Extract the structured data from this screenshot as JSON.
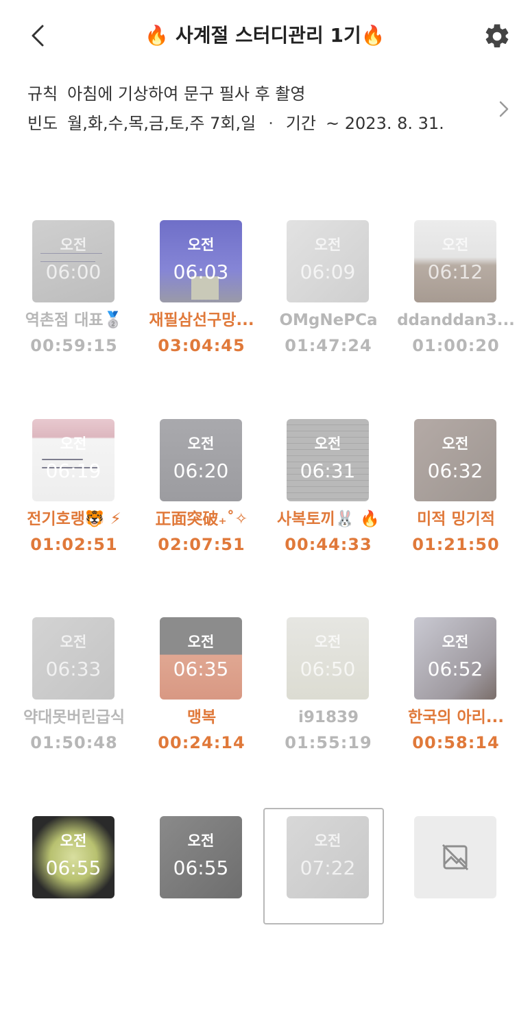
{
  "header": {
    "title": "🔥 사계절 스터디관리 1기🔥"
  },
  "info": {
    "rule_label": "규칙",
    "rule_value": "아침에 기상하여 문구 필사 후 촬영",
    "freq_label": "빈도",
    "freq_value": "월,화,수,목,금,토,주 7회,일",
    "separator": "·",
    "period_label": "기간",
    "period_value": "~ 2023. 8. 31."
  },
  "members": [
    {
      "ampm": "오전",
      "time": "06:00",
      "name": "역촌점 대표🥈",
      "duration": "00:59:15",
      "status": "gray"
    },
    {
      "ampm": "오전",
      "time": "06:03",
      "name": "재필삼선구망...",
      "duration": "03:04:45",
      "status": "orange"
    },
    {
      "ampm": "오전",
      "time": "06:09",
      "name": "OMgNePCa",
      "duration": "01:47:24",
      "status": "gray"
    },
    {
      "ampm": "오전",
      "time": "06:12",
      "name": "ddanddan3...",
      "duration": "01:00:20",
      "status": "gray"
    },
    {
      "ampm": "오전",
      "time": "06:19",
      "name": "전기호랭🐯 ⚡",
      "duration": "01:02:51",
      "status": "orange"
    },
    {
      "ampm": "오전",
      "time": "06:20",
      "name": "正面突破₊˚✧",
      "duration": "02:07:51",
      "status": "orange"
    },
    {
      "ampm": "오전",
      "time": "06:31",
      "name": "사복토끼🐰 🔥",
      "duration": "00:44:33",
      "status": "orange"
    },
    {
      "ampm": "오전",
      "time": "06:32",
      "name": "미적 밍기적",
      "duration": "01:21:50",
      "status": "orange"
    },
    {
      "ampm": "오전",
      "time": "06:33",
      "name": "약대못버린급식",
      "duration": "01:50:48",
      "status": "gray"
    },
    {
      "ampm": "오전",
      "time": "06:35",
      "name": "맹복",
      "duration": "00:24:14",
      "status": "orange"
    },
    {
      "ampm": "오전",
      "time": "06:50",
      "name": "i91839",
      "duration": "01:55:19",
      "status": "gray"
    },
    {
      "ampm": "오전",
      "time": "06:52",
      "name": "한국의 아리...",
      "duration": "00:58:14",
      "status": "orange"
    },
    {
      "ampm": "오전",
      "time": "06:55",
      "name": "",
      "duration": "",
      "status": "gray"
    },
    {
      "ampm": "오전",
      "time": "06:55",
      "name": "",
      "duration": "",
      "status": "gray"
    },
    {
      "ampm": "오전",
      "time": "07:22",
      "name": "",
      "duration": "",
      "status": "gray"
    },
    {
      "ampm": "",
      "time": "",
      "name": "",
      "duration": "",
      "status": "gray"
    }
  ],
  "icons": {
    "back": "chevron-left-icon",
    "settings": "gear-icon",
    "info_more": "chevron-right-icon",
    "no_image": "image-off-icon"
  },
  "colors": {
    "orange": "#e0793a",
    "gray": "#b7b7b7",
    "text": "#333333"
  }
}
